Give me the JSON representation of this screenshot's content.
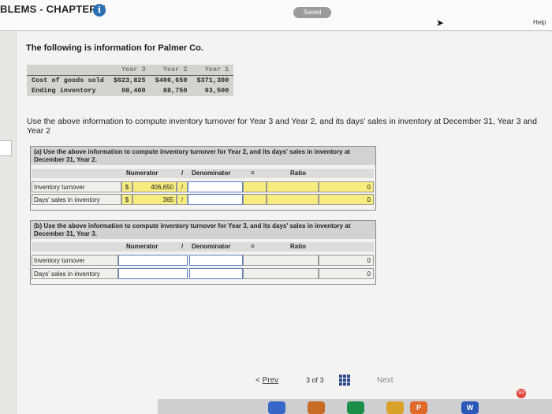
{
  "header": {
    "title": "BLEMS - CHAPTER 5",
    "info_icon": "i",
    "saved": "Saved",
    "help": "Help"
  },
  "problem": {
    "intro": "The following is information for Palmer Co."
  },
  "given": {
    "columns": [
      "Year 3",
      "Year 2",
      "Year 1"
    ],
    "rows": [
      {
        "label": "Cost of goods sold",
        "values": [
          "$623,825",
          "$406,650",
          "$371,300"
        ]
      },
      {
        "label": "Ending inventory",
        "values": [
          "98,400",
          "88,750",
          "93,500"
        ]
      }
    ]
  },
  "instructions": "Use the above information to compute inventory turnover for Year 3 and Year 2, and its days' sales in inventory at December 31, Year 3 and Year 2",
  "part_a": {
    "heading": "(a) Use the above information to compute inventory turnover for Year 2, and its days' sales in inventory at December 31, Year 2.",
    "col_numerator": "Numerator",
    "col_denominator": "Denominator",
    "col_slash": "/",
    "col_equals": "=",
    "col_ratio": "Ratio",
    "rows": [
      {
        "label": "Inventory turnover",
        "currency": "$",
        "numerator": "406,650",
        "slash": "/",
        "ratio": "0"
      },
      {
        "label": "Days' sales in inventory",
        "currency": "$",
        "numerator": "365",
        "slash": "/",
        "ratio": "0"
      }
    ]
  },
  "part_b": {
    "heading": "(b) Use the above information to compute inventory turnover for Year 3, and its days' sales in inventory at December 31, Year 3.",
    "col_numerator": "Numerator",
    "col_denominator": "Denominator",
    "col_slash": "/",
    "col_equals": "=",
    "col_ratio": "Ratio",
    "rows": [
      {
        "label": "Inventory turnover",
        "ratio": "0"
      },
      {
        "label": "Days' sales in inventory",
        "ratio": "0"
      }
    ]
  },
  "pager": {
    "prev": "Prev",
    "current": "3",
    "of": "of",
    "total": "3",
    "next": "Next"
  },
  "dock": {
    "badge": "93",
    "word_app": "W",
    "p_app": "P"
  },
  "colors": {
    "accent": "#2a6fb3",
    "highlight": "#f6ed7e",
    "panel": "#f4f3f1"
  }
}
